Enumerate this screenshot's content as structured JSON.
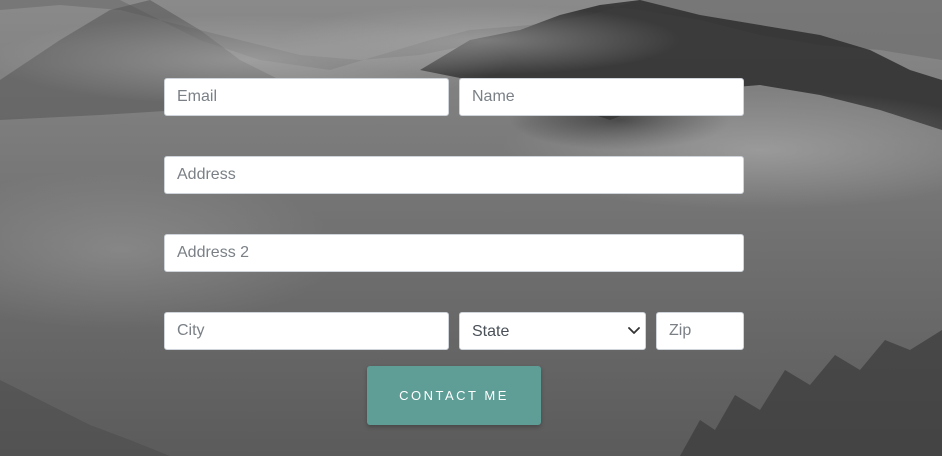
{
  "form": {
    "email_placeholder": "Email",
    "name_placeholder": "Name",
    "address_placeholder": "Address",
    "address2_placeholder": "Address 2",
    "city_placeholder": "City",
    "state_selected": "State",
    "zip_placeholder": "Zip",
    "submit_label": "Contact Me"
  },
  "icons": {
    "state_dropdown": "chevron-down-icon"
  },
  "colors": {
    "button_bg": "#5e9e97",
    "button_text": "#ffffff",
    "field_bg": "#ffffff",
    "placeholder_text": "#7a8086"
  }
}
